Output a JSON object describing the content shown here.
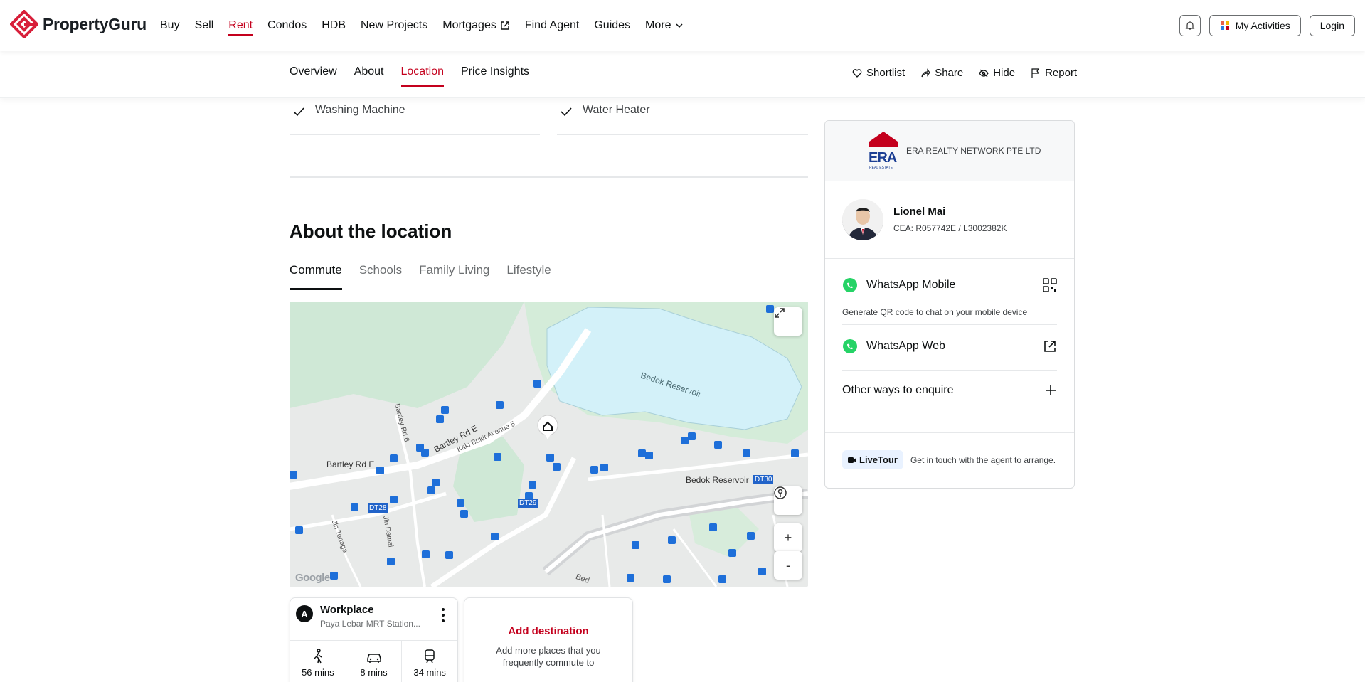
{
  "brand": {
    "name": "PropertyGuru",
    "accent": "#c4001d"
  },
  "topnav": {
    "links": [
      {
        "label": "Buy"
      },
      {
        "label": "Sell"
      },
      {
        "label": "Rent"
      },
      {
        "label": "Condos"
      },
      {
        "label": "HDB"
      },
      {
        "label": "New Projects"
      },
      {
        "label": "Mortgages"
      },
      {
        "label": "Find Agent"
      },
      {
        "label": "Guides"
      },
      {
        "label": "More"
      }
    ],
    "active": "Rent",
    "activities_label": "My Activities",
    "login_label": "Login"
  },
  "subnav": {
    "tabs": [
      {
        "label": "Overview"
      },
      {
        "label": "About"
      },
      {
        "label": "Location"
      },
      {
        "label": "Price Insights"
      }
    ],
    "active": "Location",
    "actions": [
      {
        "label": "Shortlist",
        "icon": "heart-icon"
      },
      {
        "label": "Share",
        "icon": "share-icon"
      },
      {
        "label": "Hide",
        "icon": "eye-off-icon"
      },
      {
        "label": "Report",
        "icon": "flag-icon"
      }
    ]
  },
  "amenities": [
    "Washing Machine",
    "Water Heater"
  ],
  "location": {
    "title": "About the location",
    "tabs": [
      {
        "label": "Commute"
      },
      {
        "label": "Schools"
      },
      {
        "label": "Family Living"
      },
      {
        "label": "Lifestyle"
      }
    ],
    "active_tab": "Commute",
    "map": {
      "labels": {
        "reservoir": "Bedok Reservoir",
        "reservoir_road": "Bedok Reservoir",
        "bartley_rd_e": "Bartley Rd E",
        "bartley_rd_e2": "Bartley Rd E",
        "kaki_bukit": "Kaki Bukit Avenue 5",
        "jln_tenaga": "Jln Tenaga",
        "jln_damai": "Jln Damai",
        "rd6": "Bartley Rd 6",
        "bedok_bottom": "Bed"
      },
      "mrt": [
        "DT28",
        "DT29",
        "DT30"
      ],
      "google": "Google",
      "zoom_in": "+",
      "zoom_out": "-"
    },
    "commute": {
      "workplace": {
        "badge": "A",
        "title": "Workplace",
        "subtitle": "Paya Lebar MRT Station..."
      },
      "modes": [
        {
          "icon": "walk-icon",
          "time": "56 mins"
        },
        {
          "icon": "car-icon",
          "time": "8 mins"
        },
        {
          "icon": "train-icon",
          "time": "34 mins"
        }
      ],
      "add": {
        "title": "Add destination",
        "subtitle": "Add more places that you frequently commute to"
      }
    }
  },
  "agent": {
    "agency": "ERA REALTY NETWORK PTE LTD",
    "agency_logo_text": "ERA",
    "agency_logo_sub": "REAL ESTATE",
    "name": "Lionel Mai",
    "cea": "CEA: R057742E / L3002382K",
    "whatsapp_mobile": "WhatsApp Mobile",
    "qr_hint": "Generate QR code to chat on your mobile device",
    "whatsapp_web": "WhatsApp Web",
    "other_ways": "Other ways to enquire",
    "livetour": "LiveTour",
    "livetour_desc": "Get in touch with the agent to arrange."
  }
}
